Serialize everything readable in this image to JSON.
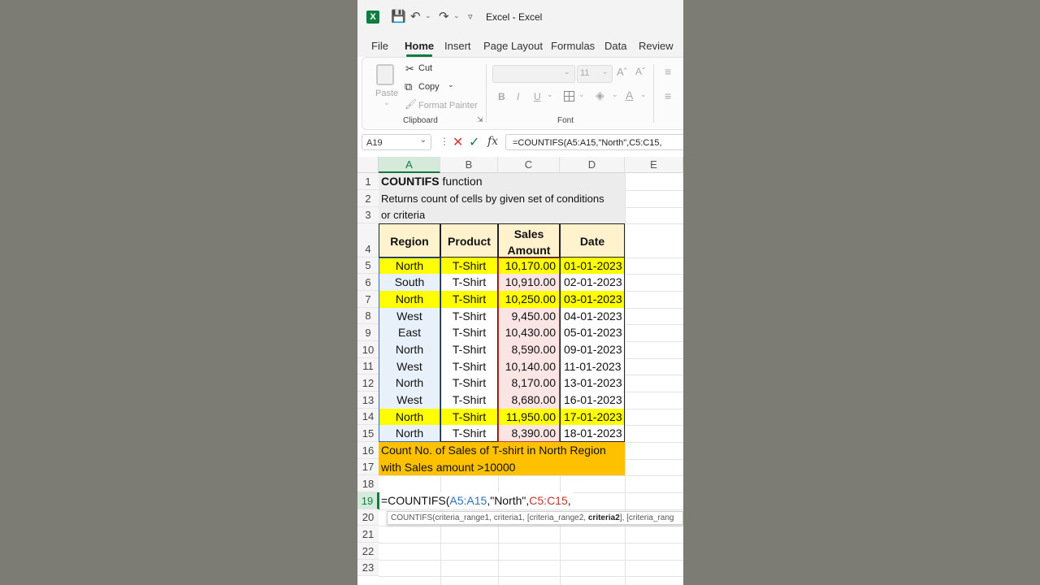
{
  "window": {
    "title": "Excel - Excel",
    "app_icon_label": "X"
  },
  "tabs": [
    "File",
    "Home",
    "Insert",
    "Page Layout",
    "Formulas",
    "Data",
    "Review"
  ],
  "ribbon": {
    "paste": "Paste",
    "cut": "Cut",
    "copy": "Copy",
    "format_painter": "Format Painter",
    "clipboard_label": "Clipboard",
    "font_size": "11",
    "font_label": "Font",
    "bold": "B",
    "italic": "I",
    "underline": "U"
  },
  "formula_bar": {
    "name_box": "A19",
    "formula": "=COUNTIFS(A5:A15,\"North\",C5:C15,"
  },
  "columns": [
    "A",
    "B",
    "C",
    "D",
    "E"
  ],
  "rows": [
    "1",
    "2",
    "3",
    "4",
    "5",
    "6",
    "7",
    "8",
    "9",
    "10",
    "11",
    "12",
    "13",
    "14",
    "15",
    "16",
    "17",
    "18",
    "19",
    "20",
    "21",
    "22",
    "23"
  ],
  "sheet": {
    "title_bold": "COUNTIFS",
    "title_rest": " function",
    "desc_line1": "Returns count of cells by given set of conditions",
    "desc_line2": "or criteria",
    "headers": {
      "region": "Region",
      "product": "Product",
      "sales_line1": "Sales",
      "sales_line2": "Amount",
      "date": "Date"
    },
    "records": [
      {
        "region": "North",
        "product": "T-Shirt",
        "amount": "10,170.00",
        "date": "01-01-2023"
      },
      {
        "region": "South",
        "product": "T-Shirt",
        "amount": "10,910.00",
        "date": "02-01-2023"
      },
      {
        "region": "North",
        "product": "T-Shirt",
        "amount": "10,250.00",
        "date": "03-01-2023"
      },
      {
        "region": "West",
        "product": "T-Shirt",
        "amount": "9,450.00",
        "date": "04-01-2023"
      },
      {
        "region": "East",
        "product": "T-Shirt",
        "amount": "10,430.00",
        "date": "05-01-2023"
      },
      {
        "region": "North",
        "product": "T-Shirt",
        "amount": "8,590.00",
        "date": "09-01-2023"
      },
      {
        "region": "West",
        "product": "T-Shirt",
        "amount": "10,140.00",
        "date": "11-01-2023"
      },
      {
        "region": "North",
        "product": "T-Shirt",
        "amount": "8,170.00",
        "date": "13-01-2023"
      },
      {
        "region": "West",
        "product": "T-Shirt",
        "amount": "8,680.00",
        "date": "16-01-2023"
      },
      {
        "region": "North",
        "product": "T-Shirt",
        "amount": "11,950.00",
        "date": "17-01-2023"
      },
      {
        "region": "North",
        "product": "T-Shirt",
        "amount": "8,390.00",
        "date": "18-01-2023"
      }
    ],
    "question_line1": "Count No. of Sales of T-shirt in North Region",
    "question_line2": "with Sales amount >10000",
    "edit_prefix": "=COUNTIFS(",
    "edit_range1": "A5:A15",
    "edit_mid": ",\"North\",",
    "edit_range2": "C5:C15",
    "edit_suffix": ",",
    "tooltip_prefix": "COUNTIFS(criteria_range1, criteria1, [criteria_range2, ",
    "tooltip_bold": "criteria2",
    "tooltip_suffix": "], [criteria_rang"
  },
  "highlighted_rows": [
    0,
    2,
    9
  ],
  "colors": {
    "excel_green": "#107c41",
    "highlight_yellow": "#ffff00",
    "header_fill": "#fff2cc",
    "question_fill": "#ffc000",
    "range1_tint": "#e8f0fa",
    "range2_tint": "#fbe4e4",
    "range1_ref": "#2f6fbd",
    "range2_ref": "#c0392b"
  }
}
